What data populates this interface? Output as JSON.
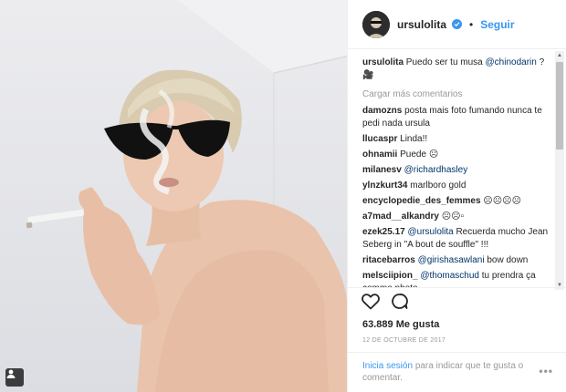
{
  "post": {
    "username": "ursulolita",
    "follow_label": "Seguir",
    "separator": "•",
    "caption_user": "ursulolita",
    "caption_text": "Puedo ser tu musa",
    "caption_mention": "@chinodarin",
    "caption_tail": "? 🎥",
    "load_more": "Cargar más comentarios",
    "likes": "63.889 Me gusta",
    "date": "12 DE OCTUBRE DE 2017",
    "login_link": "Inicia sesión",
    "login_text": "para indicar que te gusta o comentar.",
    "more_label": "•••"
  },
  "comments": [
    {
      "user": "damozns",
      "text": "posta mais foto fumando nunca te pedi nada ursula"
    },
    {
      "user": "llucaspr",
      "text": "Linda!!"
    },
    {
      "user": "ohnamii",
      "text": "Puede ☹"
    },
    {
      "user": "milanesv",
      "mention": "@richardhasley",
      "text": ""
    },
    {
      "user": "ylnzkurt34",
      "text": "marlboro gold"
    },
    {
      "user": "encyclopedie_des_femmes",
      "text": "☹☹☹☹"
    },
    {
      "user": "a7mad__alkandry",
      "text": "☹☹▫"
    },
    {
      "user": "ezek25.17",
      "mention": "@ursulolita",
      "text": "Recuerda mucho Jean Seberg in \"A bout de souffle\" !!!"
    },
    {
      "user": "ritacebarros",
      "mention": "@girishasawlani",
      "text": "bow down"
    },
    {
      "user": "melsciipion_",
      "mention": "@thomaschud",
      "text": "tu prendra ça comme photo"
    }
  ],
  "icons": {
    "heart": "heart-icon",
    "comment": "comment-icon",
    "verified": "verified-badge-icon",
    "tag": "user-tag-icon"
  },
  "colors": {
    "link": "#3897f0",
    "mention": "#003569",
    "muted": "#999999",
    "text": "#262626"
  }
}
